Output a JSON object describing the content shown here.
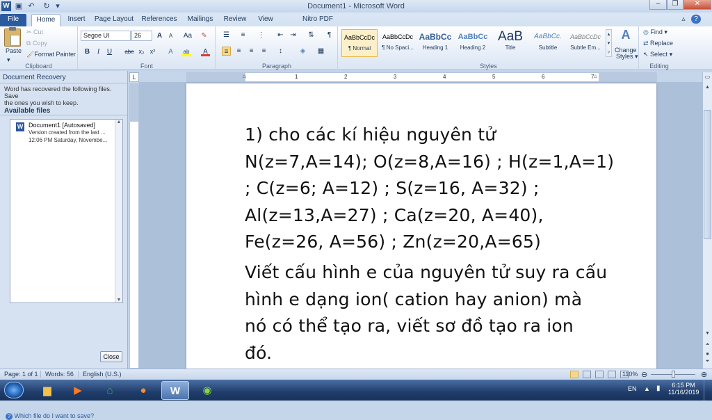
{
  "app": {
    "title": "Document1 - Microsoft Word",
    "colors": {
      "file_tab": "#2a5a9f",
      "ribbon_bg": "#e4ecf7",
      "taskbar": "#1f3d6b",
      "accent": "#f5c242"
    }
  },
  "quick_access": {
    "icons": [
      "word-icon",
      "save-icon",
      "undo-icon",
      "redo-icon",
      "customize-icon"
    ]
  },
  "tabs": [
    "File",
    "Home",
    "Insert",
    "Page Layout",
    "References",
    "Mailings",
    "Review",
    "View",
    "Nitro PDF Professional"
  ],
  "active_tab": "Home",
  "ribbon": {
    "clipboard": {
      "label": "Clipboard",
      "paste": "Paste",
      "cut": "Cut",
      "copy": "Copy",
      "format_painter": "Format Painter"
    },
    "font": {
      "label": "Font",
      "font_name": "Segoe UI",
      "font_size": "26",
      "grow": "A",
      "shrink": "A",
      "change_case": "Aa",
      "bold": "B",
      "italic": "I",
      "underline": "U",
      "strike": "abe",
      "subscript": "x₂",
      "superscript": "x²",
      "effects": "A",
      "highlight": "ab",
      "font_color": "A"
    },
    "paragraph": {
      "label": "Paragraph"
    },
    "styles": {
      "label": "Styles",
      "items": [
        {
          "preview": "AaBbCcDc",
          "name": "¶ Normal"
        },
        {
          "preview": "AaBbCcDc",
          "name": "¶ No Spaci..."
        },
        {
          "preview": "AaBbCc",
          "name": "Heading 1"
        },
        {
          "preview": "AaBbCc",
          "name": "Heading 2"
        },
        {
          "preview": "AaB",
          "name": "Title"
        },
        {
          "preview": "AaBbCc.",
          "name": "Subtitle"
        },
        {
          "preview": "AaBbCcDc",
          "name": "Subtle Em..."
        }
      ],
      "change_styles_1": "Change",
      "change_styles_2": "Styles"
    },
    "editing": {
      "label": "Editing",
      "find": "Find",
      "replace": "Replace",
      "select": "Select"
    }
  },
  "recovery_pane": {
    "title": "Document Recovery",
    "message_1": "Word has recovered the following files.  Save",
    "message_2": "the ones you wish to keep.",
    "available_files": "Available files",
    "file": {
      "name": "Document1  [Autosaved]",
      "line2": "Version created from the last ...",
      "line3": "12:06 PM Saturday, Novembe..."
    },
    "help_link": "Which file do I want to save?",
    "close_button": "Close"
  },
  "ruler": {
    "numbers": [
      "1",
      "2",
      "3",
      "4",
      "5",
      "6",
      "7"
    ]
  },
  "document": {
    "lines": [
      "1) cho các kí hiệu nguyên tử",
      "N(z=7,A=14); O(z=8,A=16) ; H(z=1,A=1)",
      "; C(z=6; A=12) ; S(z=16, A=32) ;",
      "Al(z=13,A=27) ; Ca(z=20, A=40),",
      "Fe(z=26, A=56) ; Zn(z=20,A=65)",
      "Viết cấu hình e của nguyên tử suy ra cấu",
      "hình e dạng ion( cation hay anion) mà",
      "nó có thể tạo ra, viết sơ đồ tạo ra ion",
      "đó."
    ]
  },
  "status_bar": {
    "page": "Page: 1 of 1",
    "words": "Words: 56",
    "language": "English (U.S.)",
    "zoom": "110%",
    "zoom_level": 110
  },
  "taskbar": {
    "language": "EN",
    "time": "6:15 PM",
    "date": "11/16/2019"
  }
}
